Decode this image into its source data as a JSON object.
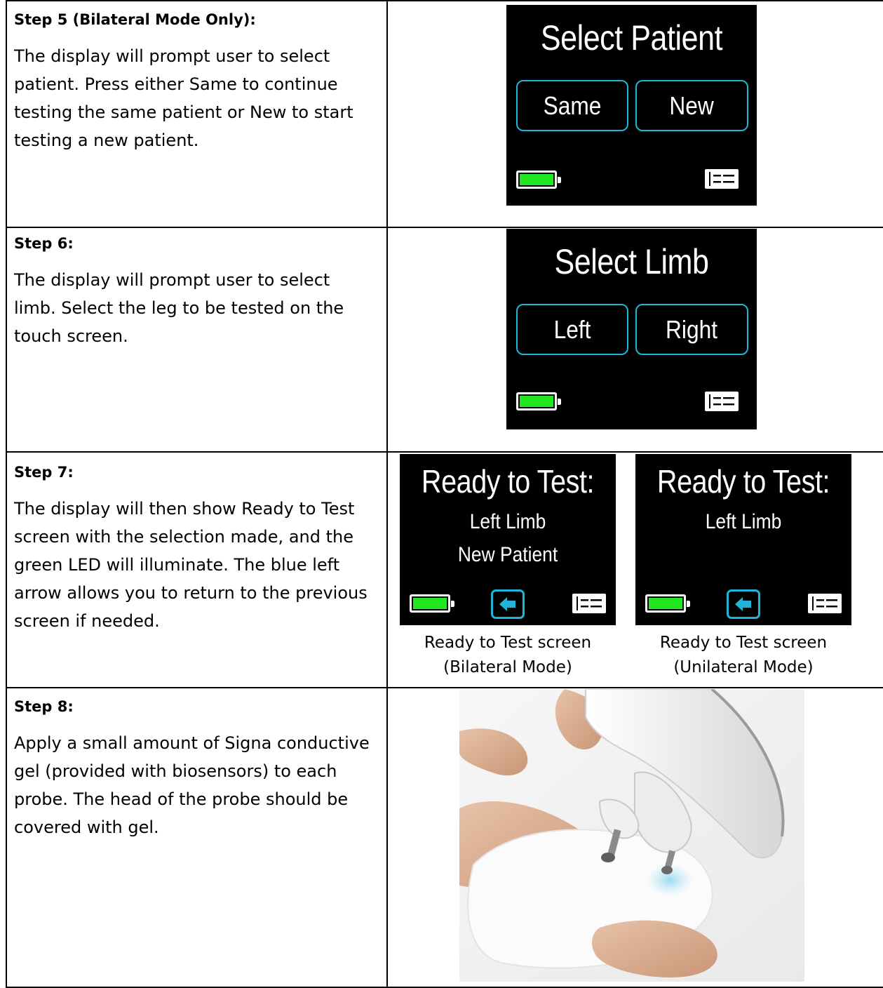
{
  "steps": [
    {
      "title": "Step 5 (Bilateral Mode Only):",
      "body": "The display will prompt user to select patient. Press either Same to continue testing the same patient or New to start testing a new patient.",
      "screen": {
        "title": "Select Patient",
        "buttons": [
          "Same",
          "New"
        ]
      }
    },
    {
      "title": "Step 6:",
      "body": "The display will prompt user to select limb. Select the leg to be tested on the touch screen.",
      "screen": {
        "title": "Select Limb",
        "buttons": [
          "Left",
          "Right"
        ]
      }
    },
    {
      "title": "Step 7:",
      "body": "The display will then show Ready to Test screen with the selection made, and the green LED will illuminate. The blue left arrow allows you to return to the previous screen if needed.",
      "screens": [
        {
          "title": "Ready to Test:",
          "line1": "Left Limb",
          "line2": "New Patient",
          "caption_line1": "Ready to Test screen",
          "caption_line2": "(Bilateral Mode)"
        },
        {
          "title": "Ready to Test:",
          "line1": "Left Limb",
          "line2": "",
          "caption_line1": "Ready to Test screen",
          "caption_line2": "(Unilateral Mode)"
        }
      ]
    },
    {
      "title": "Step 8:",
      "body": "Apply a small amount of Signa conductive gel (provided with biosensors) to each probe. The head of the probe should be covered with gel."
    }
  ],
  "colors": {
    "accent": "#1fb5d6",
    "battery": "#22e622",
    "screen_bg": "#000000"
  },
  "icons": [
    "battery-icon",
    "menu-icon",
    "back-arrow-icon"
  ]
}
